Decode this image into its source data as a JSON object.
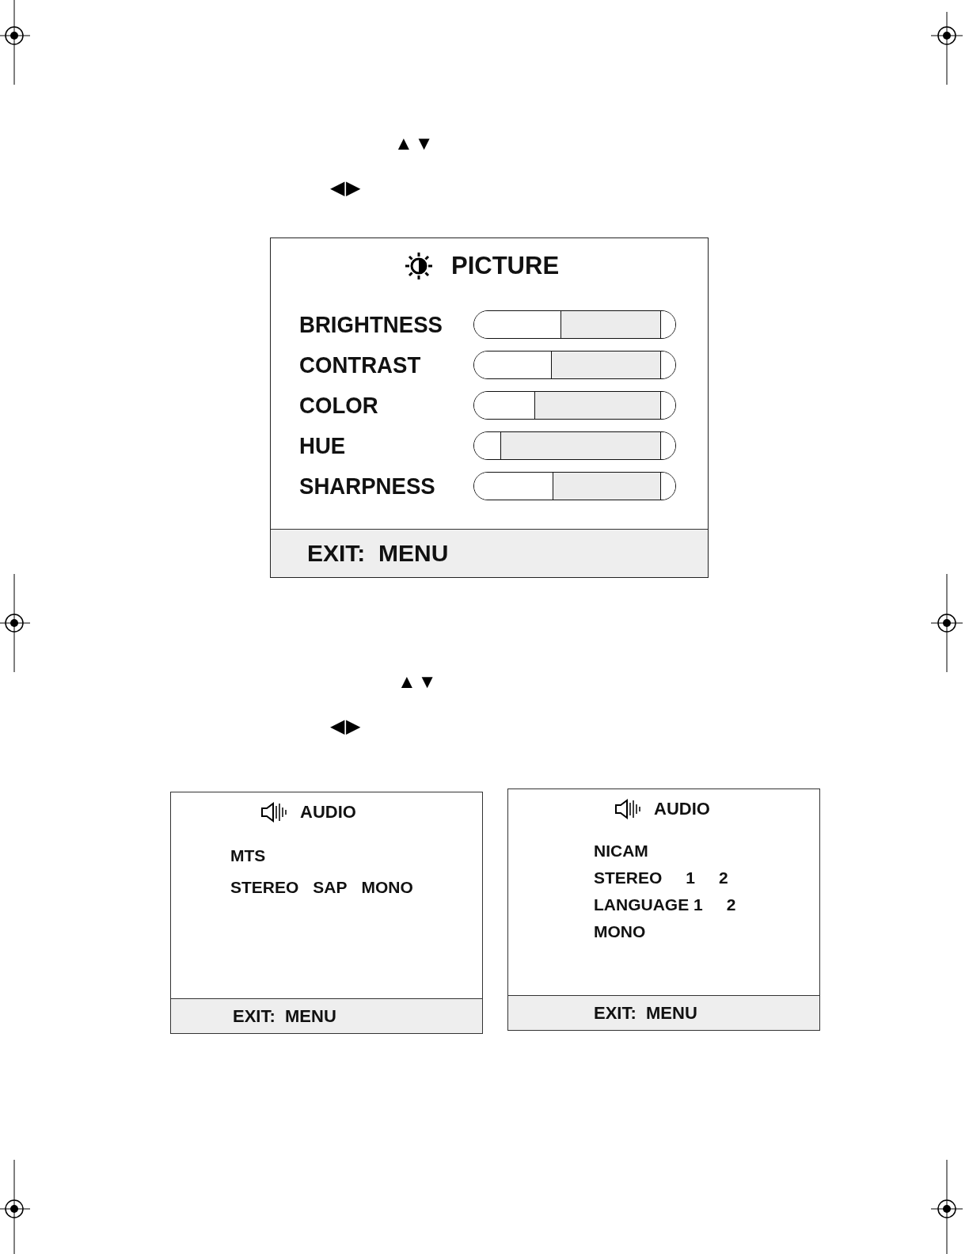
{
  "hints_top": [
    "▲▼",
    "◀▶"
  ],
  "picture_menu": {
    "title": "PICTURE",
    "items": [
      {
        "label": "BRIGHTNESS",
        "level": 0.46
      },
      {
        "label": "CONTRAST",
        "level": 0.41
      },
      {
        "label": "COLOR",
        "level": 0.32
      },
      {
        "label": "HUE",
        "level": 0.14
      },
      {
        "label": "SHARPNESS",
        "level": 0.42
      }
    ],
    "footer": "EXIT:  MENU"
  },
  "hints_bottom": [
    "▲▼",
    "◀▶"
  ],
  "audio_menus": [
    {
      "title": "AUDIO",
      "heading": "MTS",
      "rows": [
        [
          "STEREO",
          "SAP",
          "MONO"
        ]
      ],
      "footer": "EXIT:  MENU"
    },
    {
      "title": "AUDIO",
      "heading": "NICAM",
      "rows": [
        [
          "STEREO",
          "1",
          "2"
        ],
        [
          "LANGUAGE 1",
          "2"
        ],
        [
          "MONO"
        ]
      ],
      "footer": "EXIT:  MENU"
    }
  ]
}
